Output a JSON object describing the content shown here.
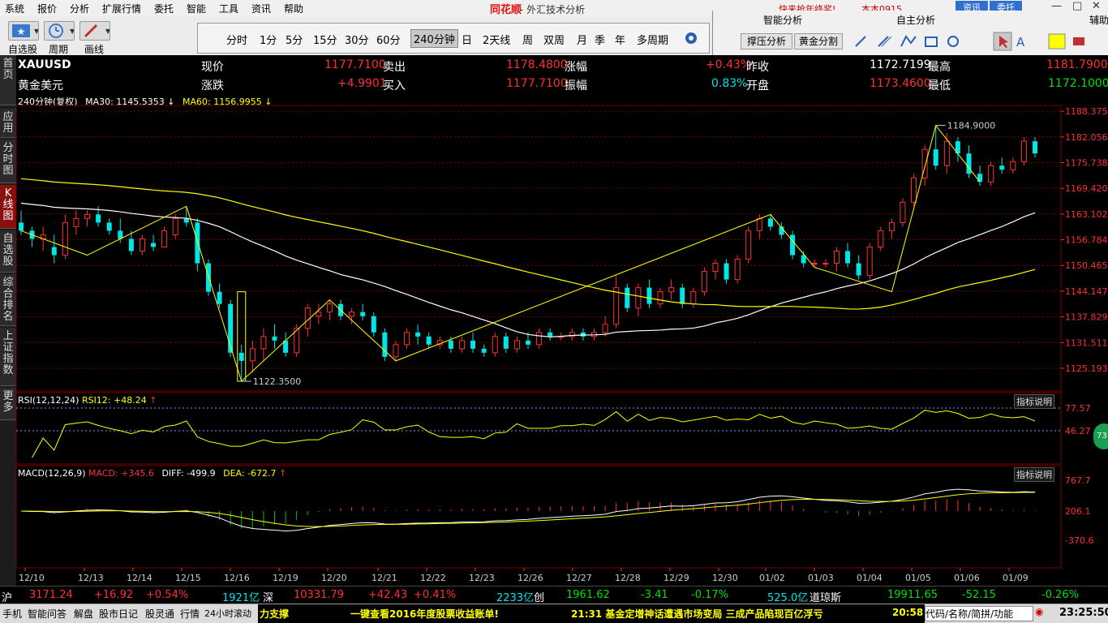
{
  "menu": [
    "系统",
    "报价",
    "分析",
    "扩展行情",
    "委托",
    "智能",
    "工具",
    "资讯",
    "帮助"
  ],
  "app": {
    "logo": "同花顺",
    "subtitle": "- 外汇技术分析",
    "promo": "快来抢年终奖!",
    "user": "本本0915",
    "buttons": [
      "资讯",
      "委托"
    ]
  },
  "toolbar": {
    "left_labels": [
      "自选股",
      "周期",
      "画线"
    ]
  },
  "periods": [
    "分时",
    "1分",
    "5分",
    "15分",
    "30分",
    "60分",
    "240分钟",
    "日",
    "2天线",
    "周",
    "双周",
    "月",
    "季",
    "年",
    "多周期"
  ],
  "active_period": "240分钟",
  "right_panel": {
    "smart_title": "智能分析",
    "self_title": "自主分析",
    "smart_buttons": [
      "撑压分析",
      "黄金分割"
    ],
    "corner": "辅助"
  },
  "leftnav": [
    "首页",
    "应用",
    "分时图",
    "K线图",
    "自选股",
    "综合排名",
    "上证指数",
    "更多"
  ],
  "quote": {
    "symbol": "XAUUSD",
    "name": "黄金美元",
    "labels": {
      "price": "现价",
      "change": "涨跌",
      "sell": "卖出",
      "buy": "买入",
      "pct": "涨幅",
      "amp": "振幅",
      "prev": "昨收",
      "open": "开盘",
      "high": "最高",
      "low": "最低"
    },
    "price": "1177.7100",
    "change": "+4.9901",
    "sell": "1178.4800",
    "buy": "1177.7100",
    "pct": "+0.43%",
    "amp": "0.83%",
    "prev": "1172.7199",
    "open": "1173.4600",
    "high": "1181.7900",
    "low": "1172.1000"
  },
  "ma_line": {
    "period": "240分钟(复权)",
    "ma30": "MA30: 1145.5353",
    "ma60": "MA60: 1156.9955"
  },
  "price_axis": [
    "1188.3750",
    "1182.0568",
    "1175.7386",
    "1169.4205",
    "1163.1023",
    "1156.7841",
    "1150.4659",
    "1144.1477",
    "1137.8295",
    "1131.5114",
    "1125.1932"
  ],
  "annotations": {
    "high": "1184.9000",
    "low": "1122.3500"
  },
  "rsi": {
    "label": "RSI(12,12,24)",
    "value": "RSI12: +48.24",
    "axis": [
      "77.57",
      "46.27"
    ],
    "help": "指标说明",
    "badge": "73"
  },
  "macd": {
    "label": "MACD(12,26,9)",
    "macd": "MACD: +345.6",
    "diff": "DIFF: -499.9",
    "dea": "DEA: -672.7",
    "axis": [
      "767.7",
      "206.1",
      "-370.6"
    ],
    "help": "指标说明"
  },
  "xaxis": [
    "12/10",
    "12/13",
    "12/14",
    "12/15",
    "12/16",
    "12/19",
    "12/20",
    "12/21",
    "12/22",
    "12/23",
    "12/26",
    "12/27",
    "12/28",
    "12/29",
    "12/30",
    "01/02",
    "01/03",
    "01/04",
    "01/05",
    "01/06",
    "01/09"
  ],
  "status": [
    {
      "t": "沪",
      "c": "w"
    },
    {
      "t": "3171.24",
      "c": "r"
    },
    {
      "t": "+16.92",
      "c": "r"
    },
    {
      "t": "+0.54%",
      "c": "r"
    },
    {
      "t": "1921亿",
      "c": "c"
    },
    {
      "t": "深",
      "c": "w"
    },
    {
      "t": "10331.79",
      "c": "r"
    },
    {
      "t": "+42.43",
      "c": "r"
    },
    {
      "t": "+0.41%",
      "c": "r"
    },
    {
      "t": "2233亿",
      "c": "c"
    },
    {
      "t": "创",
      "c": "w"
    },
    {
      "t": "1961.62",
      "c": "g"
    },
    {
      "t": "-3.41",
      "c": "g"
    },
    {
      "t": "-0.17%",
      "c": "g"
    },
    {
      "t": "525.0亿",
      "c": "c"
    },
    {
      "t": "道琼斯",
      "c": "w"
    },
    {
      "t": "19911.65",
      "c": "g"
    },
    {
      "t": "-52.15",
      "c": "g"
    },
    {
      "t": "-0.26%",
      "c": "g"
    }
  ],
  "bottom": {
    "items": [
      "手机",
      "智能问答",
      "解盘",
      "股市日记",
      "股灵通",
      "行情",
      "24小时滚动"
    ],
    "tickers": [
      "力支撑",
      "一键查看2016年度股票收益账单!",
      "21:31 基金定增神话遭遇市场变局 三成产品陷现百亿浮亏",
      "20:58"
    ],
    "search": "代码/名称/简拼/功能",
    "clock": "23:25:50"
  },
  "colors": {
    "up": "#ff3030",
    "down": "#00e5e5",
    "ma30": "#ffffff",
    "ma60": "#ffff00",
    "grid": "#7a0000"
  },
  "chart_data": {
    "type": "candlestick",
    "ylim": [
      1120,
      1189
    ],
    "candles": [
      [
        1161,
        1164,
        1158,
        1159
      ],
      [
        1159,
        1160,
        1155,
        1157
      ],
      [
        1157,
        1160,
        1154,
        1158
      ],
      [
        1155,
        1158,
        1151,
        1153
      ],
      [
        1153,
        1163,
        1152,
        1161
      ],
      [
        1160,
        1164,
        1158,
        1162
      ],
      [
        1162,
        1164,
        1160,
        1163
      ],
      [
        1163,
        1165,
        1160,
        1161
      ],
      [
        1161,
        1162,
        1158,
        1159
      ],
      [
        1159,
        1162,
        1156,
        1157
      ],
      [
        1157,
        1159,
        1153,
        1154
      ],
      [
        1154,
        1158,
        1153,
        1157
      ],
      [
        1156,
        1158,
        1154,
        1155
      ],
      [
        1155,
        1160,
        1155,
        1159
      ],
      [
        1158,
        1163,
        1157,
        1162
      ],
      [
        1162,
        1165,
        1160,
        1161
      ],
      [
        1161,
        1162,
        1149,
        1151
      ],
      [
        1151,
        1152,
        1143,
        1144
      ],
      [
        1144,
        1146,
        1140,
        1141
      ],
      [
        1141,
        1142,
        1128,
        1129
      ],
      [
        1129,
        1131,
        1122,
        1127
      ],
      [
        1127,
        1132,
        1124,
        1130
      ],
      [
        1130,
        1135,
        1127,
        1133
      ],
      [
        1133,
        1136,
        1130,
        1132
      ],
      [
        1132,
        1134,
        1128,
        1129
      ],
      [
        1129,
        1136,
        1128,
        1135
      ],
      [
        1135,
        1141,
        1133,
        1140
      ],
      [
        1138,
        1141,
        1136,
        1139
      ],
      [
        1139,
        1142,
        1137,
        1141
      ],
      [
        1141,
        1142,
        1137,
        1138
      ],
      [
        1138,
        1140,
        1136,
        1139
      ],
      [
        1139,
        1141,
        1137,
        1138
      ],
      [
        1138,
        1139,
        1133,
        1134
      ],
      [
        1134,
        1135,
        1127,
        1128
      ],
      [
        1128,
        1132,
        1127,
        1131
      ],
      [
        1131,
        1135,
        1130,
        1134
      ],
      [
        1134,
        1136,
        1131,
        1133
      ],
      [
        1133,
        1134,
        1130,
        1131
      ],
      [
        1131,
        1133,
        1130,
        1132
      ],
      [
        1132,
        1133,
        1129,
        1130
      ],
      [
        1130,
        1133,
        1129,
        1132
      ],
      [
        1132,
        1134,
        1129,
        1130
      ],
      [
        1130,
        1131,
        1128,
        1129
      ],
      [
        1129,
        1134,
        1128,
        1133
      ],
      [
        1133,
        1134,
        1129,
        1130
      ],
      [
        1130,
        1133,
        1129,
        1132
      ],
      [
        1132,
        1134,
        1130,
        1131
      ],
      [
        1131,
        1135,
        1130,
        1134
      ],
      [
        1134,
        1135,
        1132,
        1133
      ],
      [
        1133,
        1134,
        1132,
        1133
      ],
      [
        1133,
        1135,
        1132,
        1134
      ],
      [
        1134,
        1135,
        1132,
        1133
      ],
      [
        1133,
        1135,
        1132,
        1134
      ],
      [
        1134,
        1138,
        1133,
        1136
      ],
      [
        1136,
        1148,
        1135,
        1145
      ],
      [
        1145,
        1146,
        1139,
        1140
      ],
      [
        1140,
        1146,
        1138,
        1145
      ],
      [
        1145,
        1147,
        1140,
        1141
      ],
      [
        1141,
        1145,
        1140,
        1144
      ],
      [
        1144,
        1147,
        1142,
        1145
      ],
      [
        1145,
        1146,
        1140,
        1141
      ],
      [
        1141,
        1145,
        1140,
        1144
      ],
      [
        1144,
        1150,
        1143,
        1149
      ],
      [
        1149,
        1152,
        1147,
        1151
      ],
      [
        1151,
        1152,
        1146,
        1147
      ],
      [
        1147,
        1153,
        1146,
        1152
      ],
      [
        1152,
        1160,
        1151,
        1159
      ],
      [
        1159,
        1163,
        1157,
        1162
      ],
      [
        1162,
        1163,
        1159,
        1160
      ],
      [
        1160,
        1161,
        1157,
        1158
      ],
      [
        1158,
        1159,
        1152,
        1153
      ],
      [
        1153,
        1154,
        1150,
        1151
      ],
      [
        1151,
        1152,
        1150,
        1151
      ],
      [
        1151,
        1152,
        1150,
        1151
      ],
      [
        1151,
        1155,
        1149,
        1154
      ],
      [
        1154,
        1156,
        1150,
        1151
      ],
      [
        1151,
        1153,
        1147,
        1148
      ],
      [
        1148,
        1156,
        1147,
        1155
      ],
      [
        1155,
        1160,
        1154,
        1159
      ],
      [
        1159,
        1162,
        1157,
        1161
      ],
      [
        1161,
        1167,
        1160,
        1166
      ],
      [
        1166,
        1173,
        1165,
        1172
      ],
      [
        1172,
        1180,
        1170,
        1179
      ],
      [
        1179,
        1184.9,
        1174,
        1175
      ],
      [
        1175,
        1183,
        1173,
        1181
      ],
      [
        1181,
        1182,
        1176,
        1178
      ],
      [
        1178,
        1180,
        1172,
        1173
      ],
      [
        1173,
        1175,
        1170,
        1171
      ],
      [
        1171,
        1176,
        1170,
        1175
      ],
      [
        1175,
        1177,
        1173,
        1174
      ],
      [
        1174,
        1177,
        1173,
        1176
      ],
      [
        1176,
        1182,
        1175,
        1181
      ],
      [
        1181,
        1182,
        1177,
        1178
      ]
    ]
  }
}
